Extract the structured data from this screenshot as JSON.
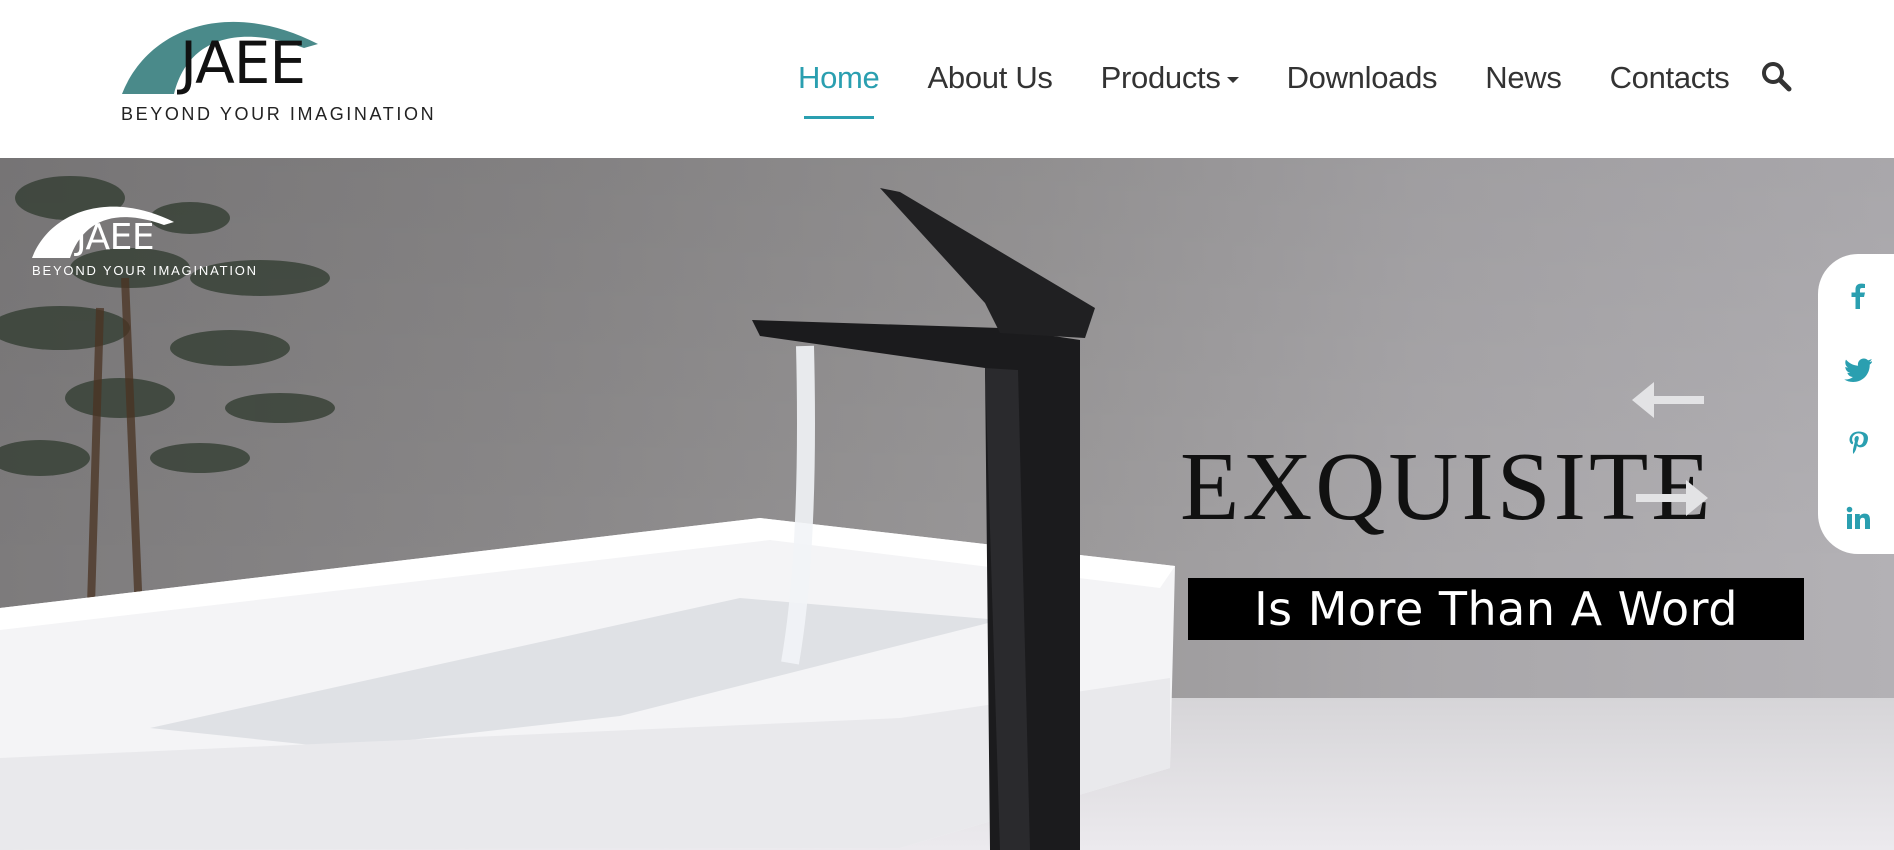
{
  "brand": {
    "name": "JAEE",
    "tagline": "BEYOND YOUR IMAGINATION",
    "arc_color": "#4a8a8a"
  },
  "nav": {
    "items": [
      {
        "label": "Home",
        "active": true
      },
      {
        "label": "About Us",
        "active": false
      },
      {
        "label": "Products",
        "active": false,
        "has_dropdown": true
      },
      {
        "label": "Downloads",
        "active": false
      },
      {
        "label": "News",
        "active": false
      },
      {
        "label": "Contacts",
        "active": false
      }
    ],
    "active_color": "#2a9fb0",
    "search_icon": "search-icon"
  },
  "hero": {
    "overlay_logo_name": "JAEE",
    "overlay_logo_tagline": "BEYOND YOUR IMAGINATION",
    "headline": "EXQUISITE",
    "subheadline": "Is More Than A Word",
    "prev_icon": "arrow-left-icon",
    "next_icon": "arrow-right-icon"
  },
  "social": {
    "icons": [
      "facebook-icon",
      "twitter-icon",
      "pinterest-icon",
      "linkedin-icon"
    ],
    "icon_color": "#2a9fb0"
  }
}
